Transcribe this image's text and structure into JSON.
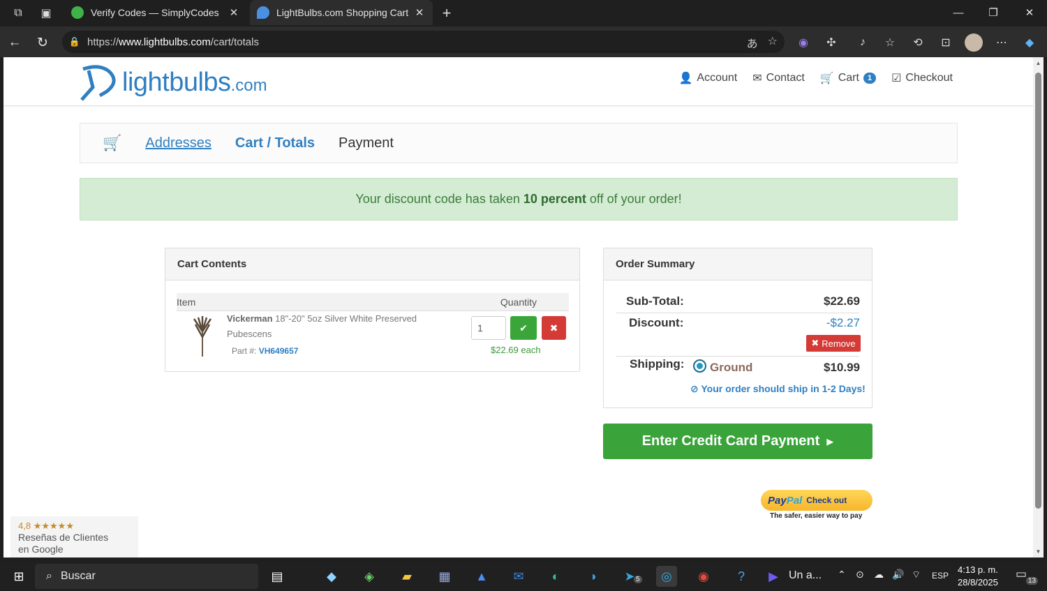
{
  "browser": {
    "tabs": [
      {
        "title": "Verify Codes — SimplyCodes",
        "active": false
      },
      {
        "title": "LightBulbs.com Shopping Cart",
        "active": true
      }
    ],
    "url_prefix": "https://",
    "url_host": "www.lightbulbs.com",
    "url_path": "/cart/totals"
  },
  "site": {
    "logo_main": "lightbulbs",
    "logo_tld": ".com",
    "nav": {
      "account": "Account",
      "contact": "Contact",
      "cart": "Cart",
      "cart_count": "1",
      "checkout": "Checkout"
    },
    "steps": {
      "addresses": "Addresses",
      "cart_totals": "Cart / Totals",
      "payment": "Payment"
    },
    "alert": {
      "prefix": "Your discount code has taken",
      "highlight": "10 percent",
      "suffix": "off of your order!"
    },
    "cart": {
      "title": "Cart Contents",
      "col_item": "Item",
      "col_qty": "Quantity",
      "item": {
        "brand": "Vickerman",
        "name": "18\"-20\" 5oz Silver White Preserved Pubescens",
        "part_label": "Part #:",
        "part_number": "VH649657",
        "quantity": "1",
        "each_price": "$22.69 each"
      }
    },
    "summary": {
      "title": "Order Summary",
      "subtotal_label": "Sub-Total:",
      "subtotal_value": "$22.69",
      "discount_label": "Discount:",
      "discount_value": "-$2.27",
      "remove_label": "Remove",
      "shipping_label": "Shipping:",
      "shipping_method": "Ground",
      "shipping_value": "$10.99",
      "ship_note": "Your order should ship in 1-2 Days!"
    },
    "cc_button": "Enter Credit Card Payment",
    "paypal": {
      "pay": "Pay",
      "pal": "Pal",
      "checkout": "Check out",
      "tagline": "The safer, easier way to pay"
    },
    "reviews": {
      "rating": "4,8",
      "stars": "★★★★★",
      "line1": "Reseñas de Clientes",
      "line2": "en Google"
    }
  },
  "taskbar": {
    "search_placeholder": "Buscar",
    "app_label": "Un a...",
    "badge_telegram": "5",
    "language": "ESP",
    "time": "4:13 p. m.",
    "date": "28/8/2025",
    "notifications": "13"
  },
  "colors": {
    "brand_blue": "#2f7fc1",
    "success_green": "#3aa33a",
    "danger_red": "#d43a36",
    "alert_bg": "#d4ecd4"
  }
}
